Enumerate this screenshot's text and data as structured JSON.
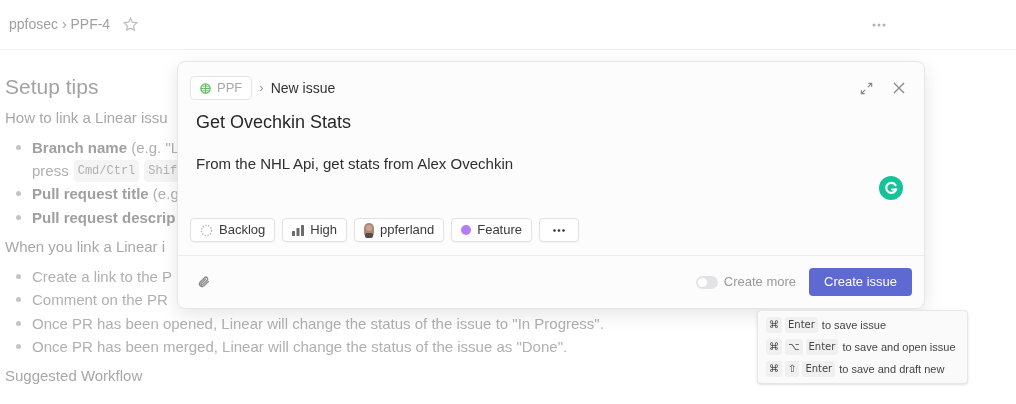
{
  "header": {
    "breadcrumb": "ppfosec › PPF-4"
  },
  "doc": [
    {
      "kind": "heading",
      "text": "Setup tips"
    },
    {
      "kind": "paragraph",
      "text": "How to link a Linear issu"
    },
    {
      "kind": "bullet",
      "text": "**Branch name** (e.g. \"L"
    },
    {
      "kind": "continuation",
      "text": "press",
      "keys": [
        "Cmd/Ctrl",
        "Shif"
      ]
    },
    {
      "kind": "bullet",
      "text": "**Pull request title** (e.g"
    },
    {
      "kind": "bullet",
      "text": "**Pull request descrip**"
    },
    {
      "kind": "paragraph",
      "text": "When you link a Linear i"
    },
    {
      "kind": "bullet",
      "text": "Create a link to the P"
    },
    {
      "kind": "bullet",
      "text": "Comment on the PR"
    },
    {
      "kind": "bullet",
      "text": "Once PR has been opened, Linear will change the status of the issue to \"In Progress\"."
    },
    {
      "kind": "bullet",
      "text": "Once PR has been merged, Linear will change the status of the issue as \"Done\"."
    },
    {
      "kind": "paragraph",
      "text": "Suggested Workflow"
    }
  ],
  "modal": {
    "team": "PPF",
    "separator": "›",
    "crumb": "New issue",
    "title": "Get Ovechkin Stats",
    "description": "From the NHL Api, get stats from Alex Ovechkin",
    "chips": [
      {
        "kind": "status",
        "label": "Backlog"
      },
      {
        "kind": "priority",
        "label": "High"
      },
      {
        "kind": "assignee",
        "label": "ppferland"
      },
      {
        "kind": "label",
        "label": "Feature",
        "color": "#b47cf6"
      },
      {
        "kind": "more"
      }
    ],
    "create_more": {
      "label": "Create more",
      "on": false
    },
    "submit": "Create issue"
  },
  "shortcuts": [
    {
      "keys": [
        "⌘",
        "Enter"
      ],
      "text": "to save issue"
    },
    {
      "keys": [
        "⌘",
        "⌥",
        "Enter"
      ],
      "text": "to save and open issue"
    },
    {
      "keys": [
        "⌘",
        "⇧",
        "Enter"
      ],
      "text": "to save and draft new"
    }
  ]
}
